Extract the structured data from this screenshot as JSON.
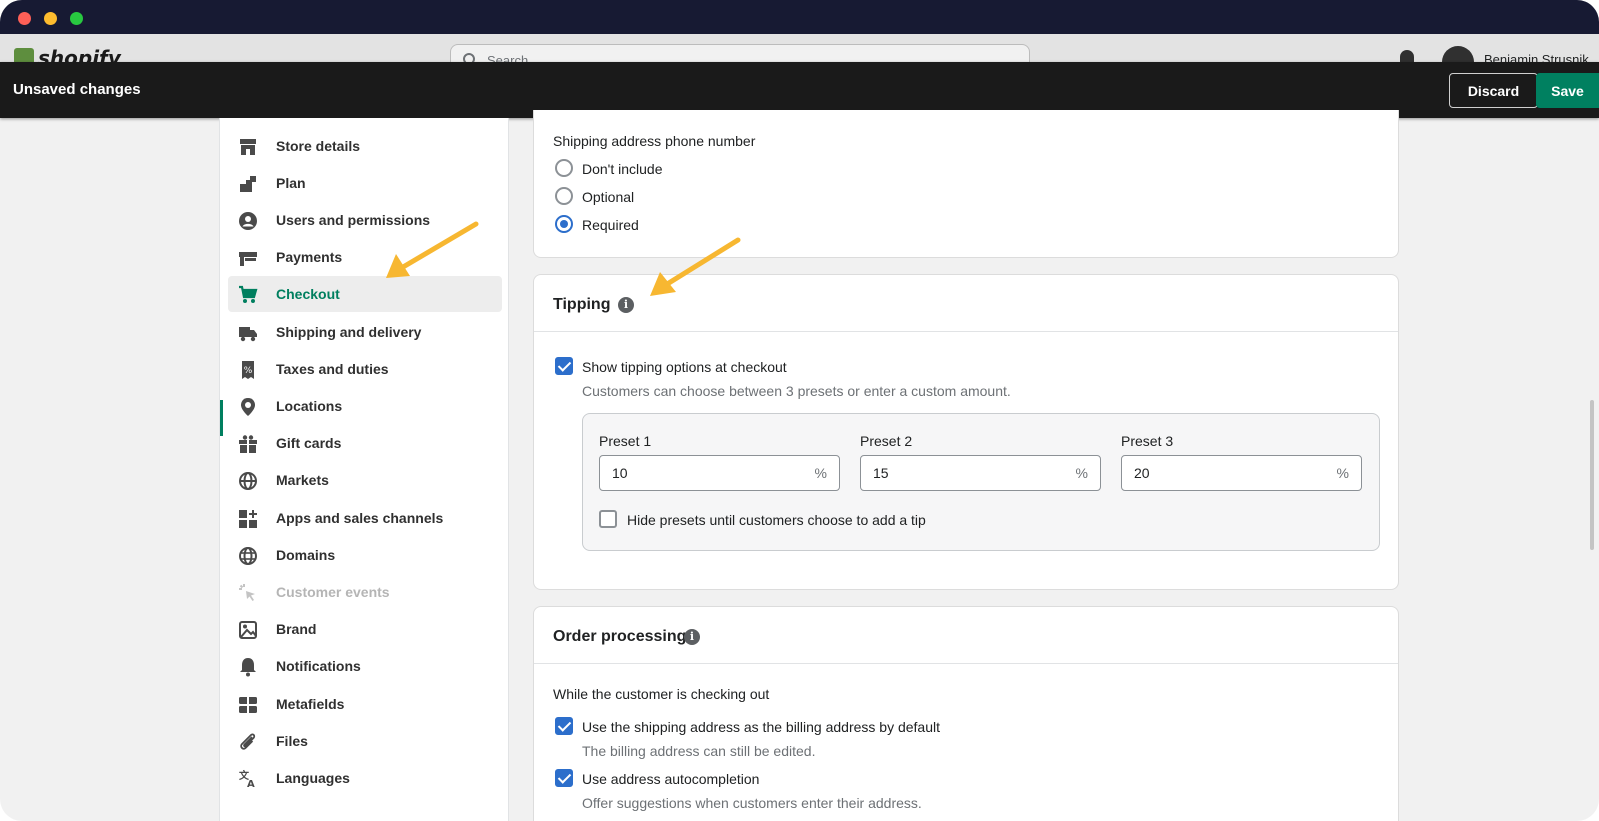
{
  "window": {
    "topbar": {
      "logo_text": "shopify",
      "search_placeholder": "Search",
      "username": "Benjamin Strusnik"
    }
  },
  "savebar": {
    "title": "Unsaved changes",
    "discard_label": "Discard",
    "save_label": "Save"
  },
  "sidebar": {
    "items": [
      {
        "label": "Store details",
        "icon": "store-icon"
      },
      {
        "label": "Plan",
        "icon": "plan-icon"
      },
      {
        "label": "Users and permissions",
        "icon": "user-icon"
      },
      {
        "label": "Payments",
        "icon": "payments-icon"
      },
      {
        "label": "Checkout",
        "icon": "cart-icon",
        "active": true
      },
      {
        "label": "Shipping and delivery",
        "icon": "truck-icon"
      },
      {
        "label": "Taxes and duties",
        "icon": "receipt-icon"
      },
      {
        "label": "Locations",
        "icon": "location-pin-icon"
      },
      {
        "label": "Gift cards",
        "icon": "gift-icon"
      },
      {
        "label": "Markets",
        "icon": "globe-icon"
      },
      {
        "label": "Apps and sales channels",
        "icon": "apps-icon"
      },
      {
        "label": "Domains",
        "icon": "domain-globe-icon"
      },
      {
        "label": "Customer events",
        "icon": "cursor-click-icon",
        "disabled": true
      },
      {
        "label": "Brand",
        "icon": "brand-image-icon"
      },
      {
        "label": "Notifications",
        "icon": "bell-icon"
      },
      {
        "label": "Metafields",
        "icon": "metafields-icon"
      },
      {
        "label": "Files",
        "icon": "paperclip-icon"
      },
      {
        "label": "Languages",
        "icon": "translate-icon"
      }
    ]
  },
  "shipping_phone": {
    "heading": "Shipping address phone number",
    "options": [
      "Don't include",
      "Optional",
      "Required"
    ],
    "selected": "Required"
  },
  "tipping": {
    "title": "Tipping",
    "show_label": "Show tipping options at checkout",
    "show_checked": true,
    "help": "Customers can choose between 3 presets or enter a custom amount.",
    "presets": [
      {
        "label": "Preset 1",
        "value": "10",
        "suffix": "%"
      },
      {
        "label": "Preset 2",
        "value": "15",
        "suffix": "%"
      },
      {
        "label": "Preset 3",
        "value": "20",
        "suffix": "%"
      }
    ],
    "hide_label": "Hide presets until customers choose to add a tip",
    "hide_checked": false
  },
  "order_processing": {
    "title": "Order processing",
    "subheading": "While the customer is checking out",
    "billing_label": "Use the shipping address as the billing address by default",
    "billing_help": "The billing address can still be edited.",
    "autocomplete_label": "Use address autocompletion",
    "autocomplete_help": "Offer suggestions when customers enter their address."
  },
  "colors": {
    "accent": "#008060",
    "active_text": "#007f5f",
    "checkbox_blue": "#2c6ecb",
    "annotation_arrow": "#f7b731"
  }
}
